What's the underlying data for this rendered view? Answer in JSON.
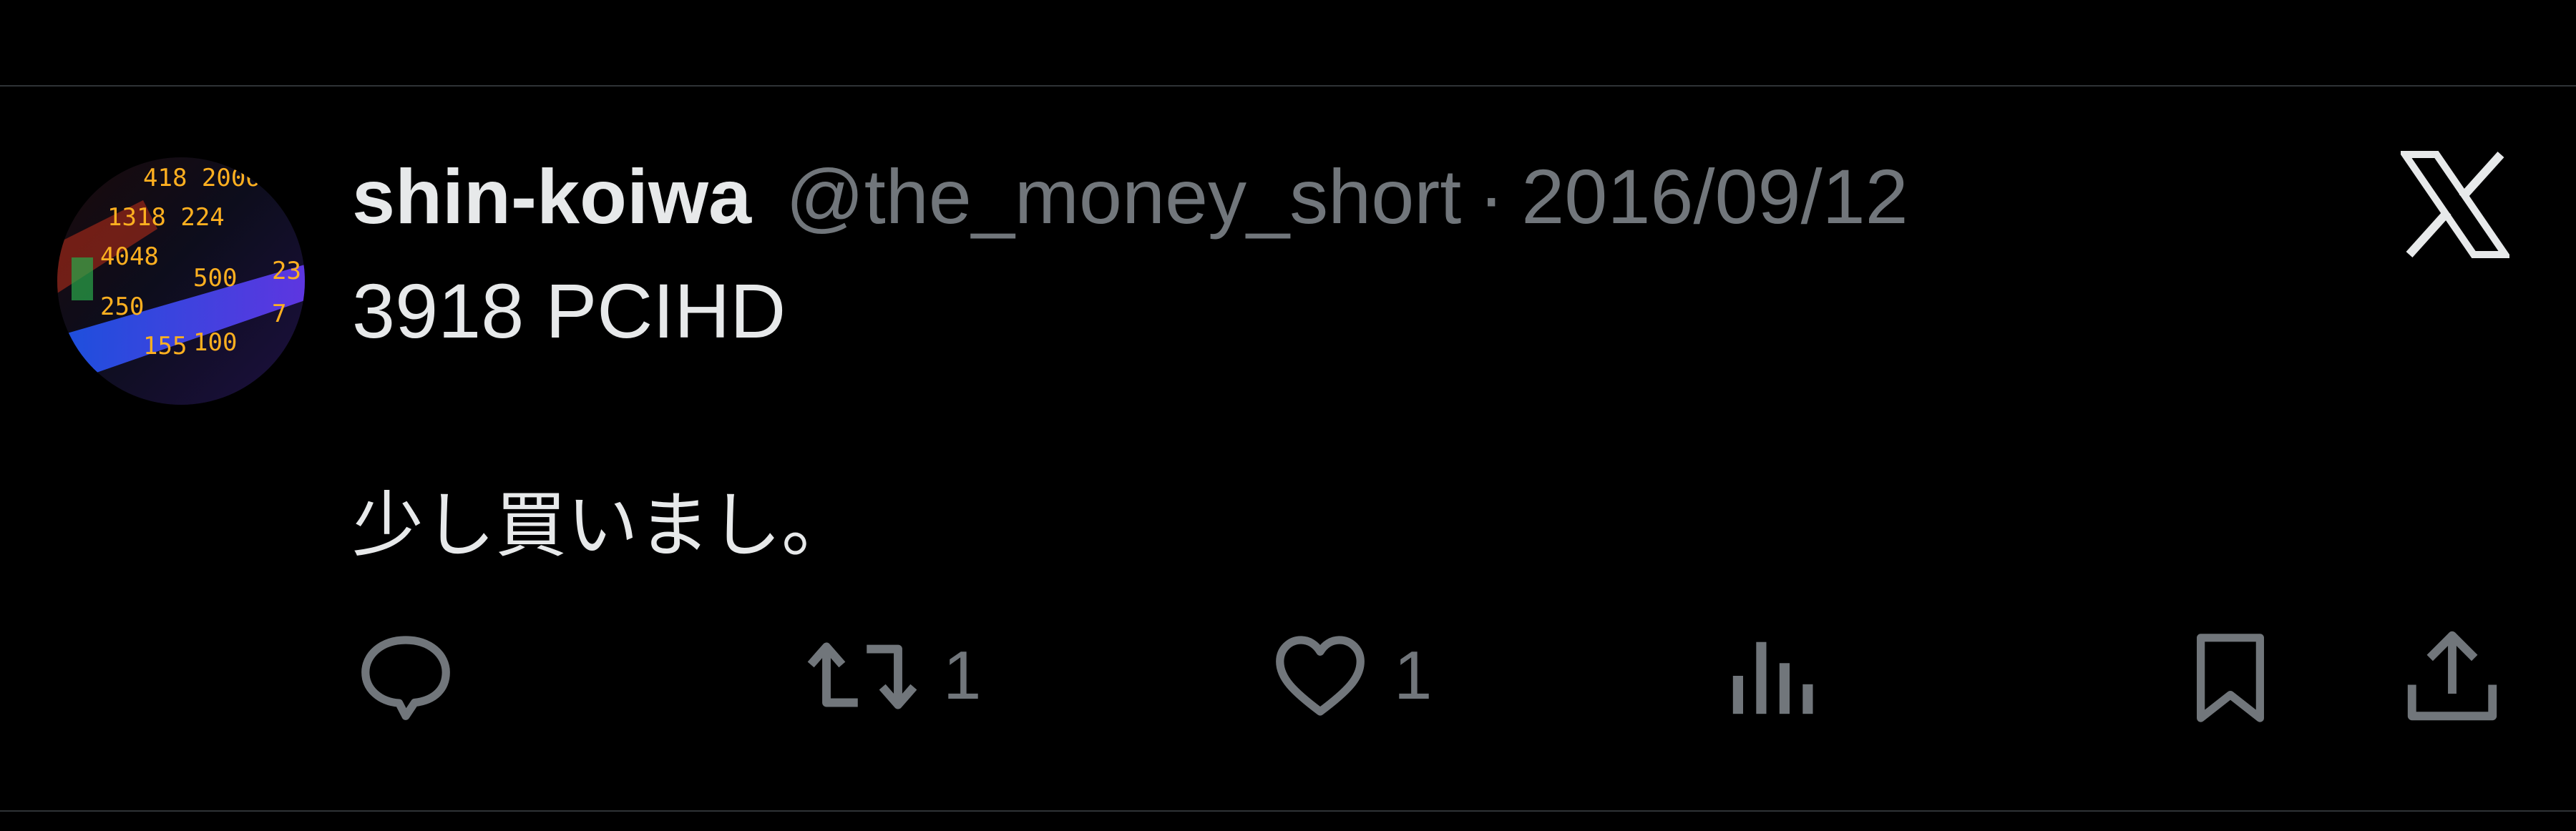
{
  "tweet": {
    "display_name": "shin-koiwa",
    "handle": "@the_money_short",
    "separator": "·",
    "date": "2016/09/12",
    "lines": [
      "3918 PCIHD",
      "",
      "少し買いまし。"
    ]
  },
  "actions": {
    "reply_icon": "reply-icon",
    "retweet_icon": "retweet-icon",
    "retweet_count": "1",
    "like_icon": "heart-icon",
    "like_count": "1",
    "views_icon": "views-icon",
    "bookmark_icon": "bookmark-icon",
    "share_icon": "share-icon"
  },
  "brand": {
    "logo": "x-logo-icon"
  },
  "colors": {
    "background": "#000000",
    "primary_text": "#e7e9ea",
    "secondary_text": "#71767b",
    "divider": "#2f3336"
  }
}
